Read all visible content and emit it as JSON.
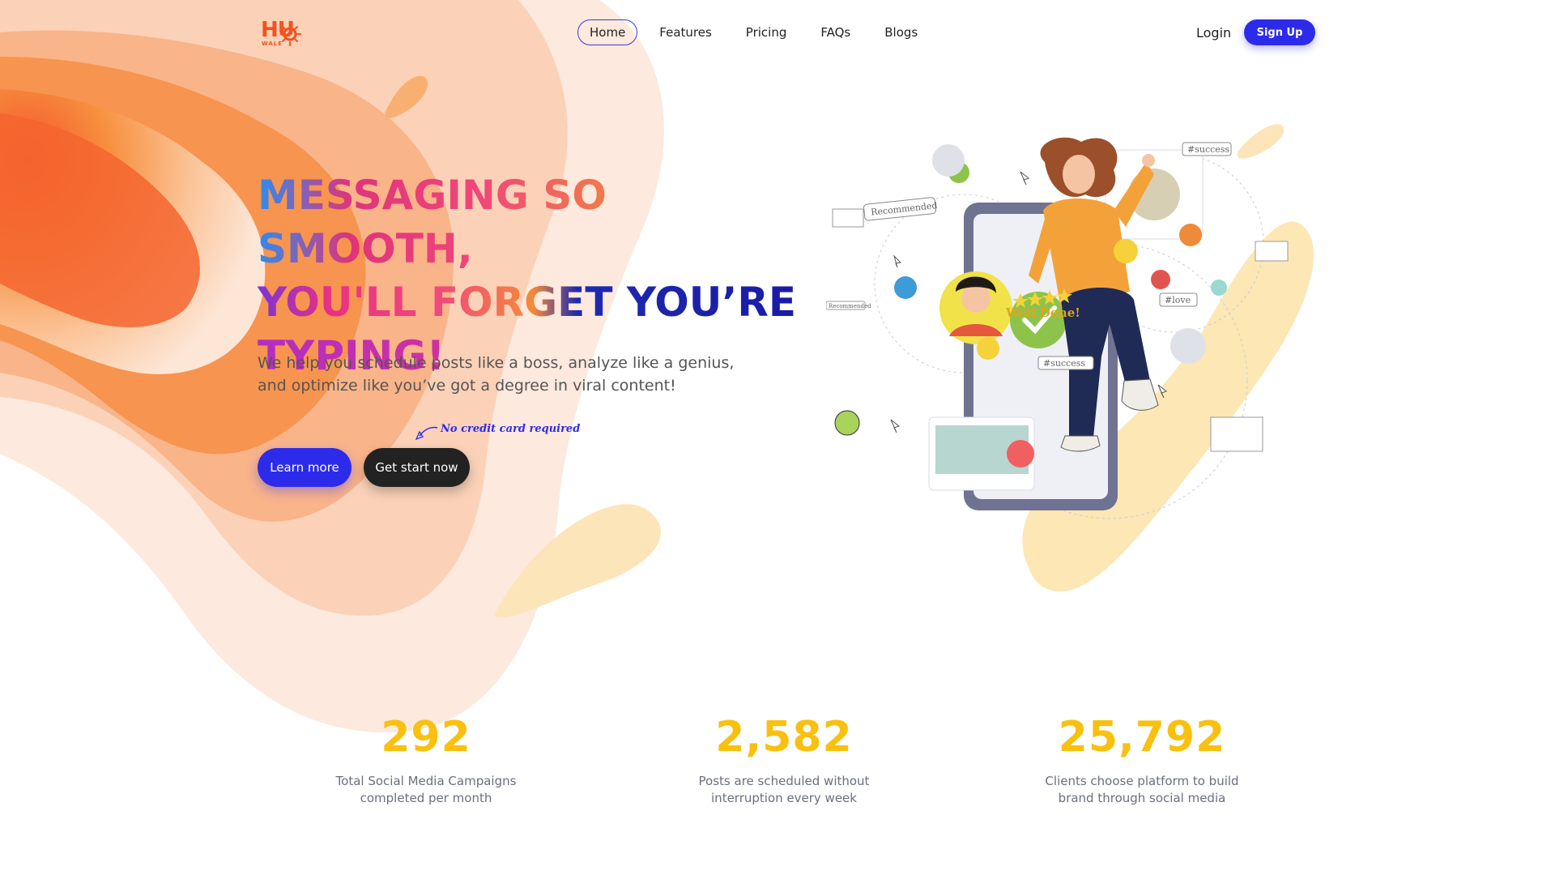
{
  "header": {
    "logo_text": "HU",
    "logo_sub": "WALE",
    "nav": [
      "Home",
      "Features",
      "Pricing",
      "FAQs",
      "Blogs"
    ],
    "active_nav": "Home",
    "login": "Login",
    "signup": "Sign Up"
  },
  "hero": {
    "title_lines": [
      "MESSAGING SO SMOOTH,",
      "YOU'LL FORGET YOU’RE",
      "TYPING!"
    ],
    "subtitle_line1": "We help you schedule posts like a boss, analyze like a genius,",
    "subtitle_line2": "and optimize like you’ve got a degree in viral content!",
    "no_cc": "No credit card required",
    "learn_more": "Learn more",
    "get_start": "Get start now"
  },
  "illustration": {
    "tags": [
      "Recommended",
      "#success",
      "#love",
      "Well Done!",
      "#success",
      "Recommended"
    ]
  },
  "stats": [
    {
      "value": "292",
      "line1": "Total Social Media Campaigns",
      "line2": "completed per month"
    },
    {
      "value": "2,582",
      "line1": "Posts are scheduled without",
      "line2": "interruption every week"
    },
    {
      "value": "25,792",
      "line1": "Clients choose platform to build",
      "line2": "brand through social media"
    }
  ],
  "colors": {
    "primary": "#2d2bea",
    "dark_button": "#222222",
    "stat_number": "#f9c00f",
    "accent_orange": "#f5511e"
  }
}
